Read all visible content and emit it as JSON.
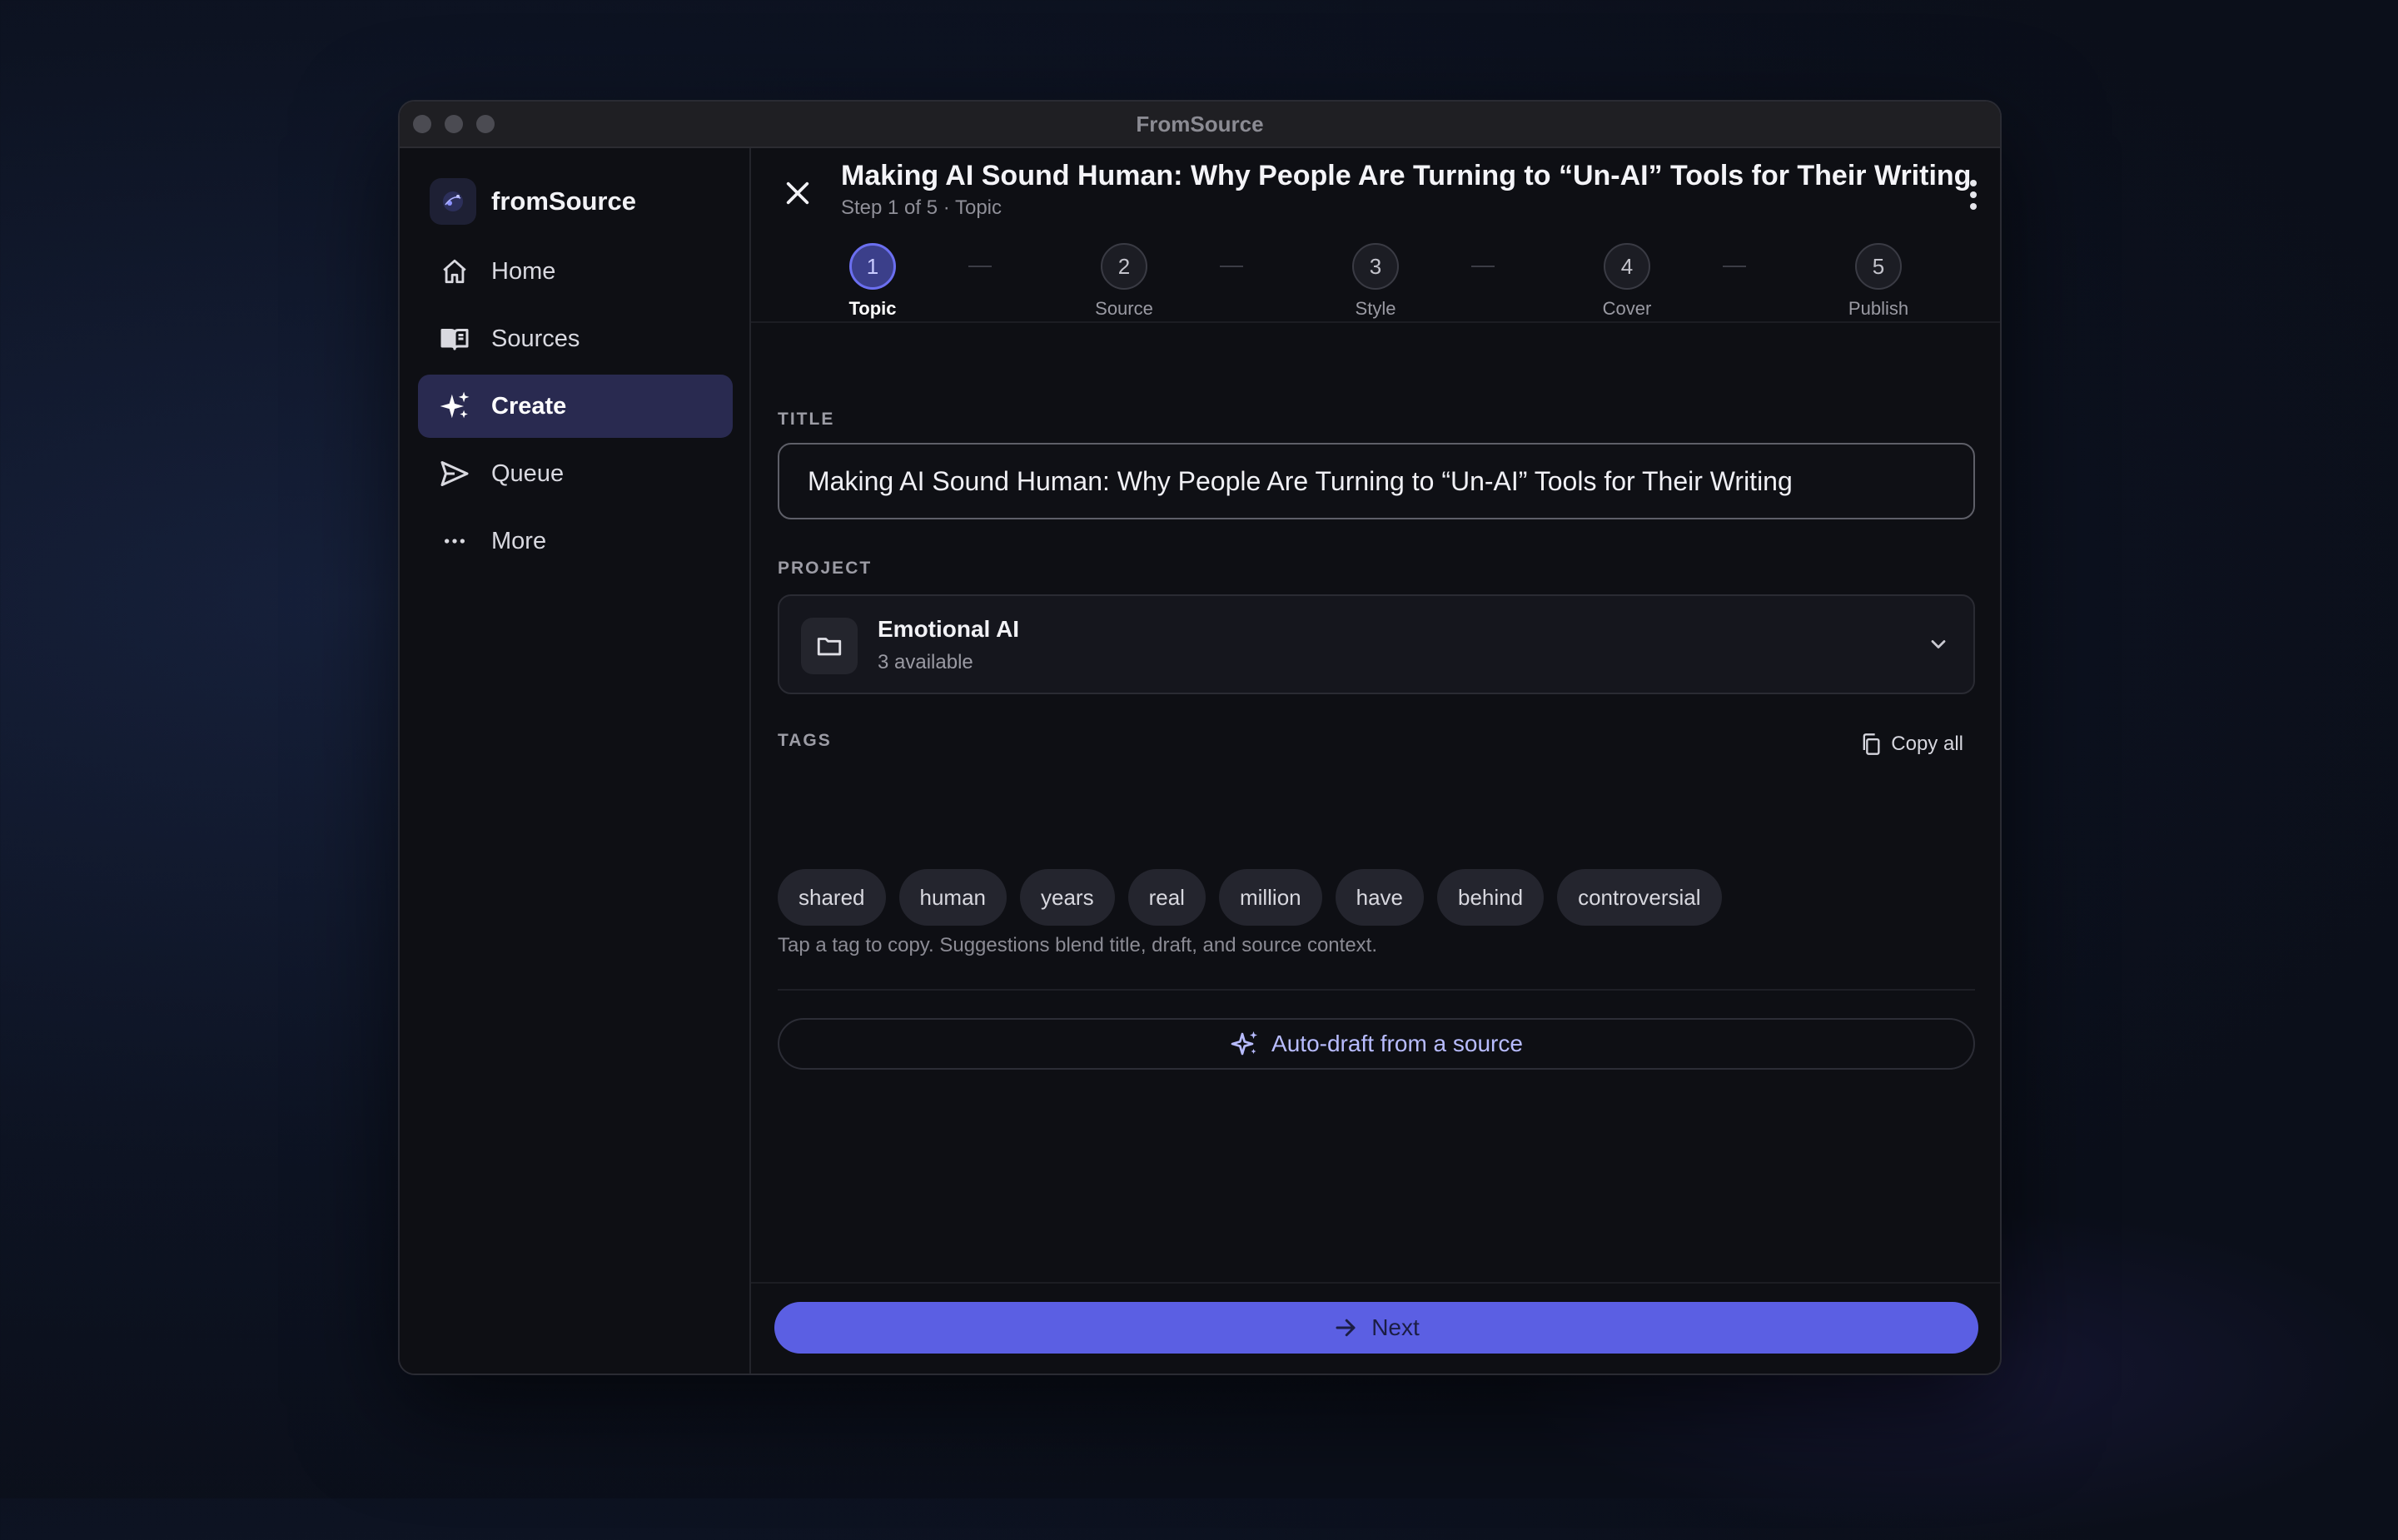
{
  "window": {
    "title": "FromSource"
  },
  "brand": {
    "name": "fromSource"
  },
  "sidebar": {
    "items": [
      {
        "label": "Home",
        "icon": "home-icon"
      },
      {
        "label": "Sources",
        "icon": "book-icon"
      },
      {
        "label": "Create",
        "icon": "sparkles-icon",
        "active": true
      },
      {
        "label": "Queue",
        "icon": "send-icon"
      },
      {
        "label": "More",
        "icon": "more-icon"
      }
    ]
  },
  "header": {
    "title": "Making AI Sound Human: Why People Are Turning to “Un-AI” Tools for Their Writing",
    "subtitle": "Step 1 of 5 · Topic"
  },
  "steps": [
    {
      "number": "1",
      "label": "Topic",
      "active": true
    },
    {
      "number": "2",
      "label": "Source"
    },
    {
      "number": "3",
      "label": "Style"
    },
    {
      "number": "4",
      "label": "Cover"
    },
    {
      "number": "5",
      "label": "Publish"
    }
  ],
  "form": {
    "title_label": "TITLE",
    "title_value": "Making AI Sound Human: Why People Are Turning to “Un-AI” Tools for Their Writing",
    "project_label": "PROJECT",
    "project_name": "Emotional AI",
    "project_sub": "3 available",
    "tags_label": "TAGS",
    "copy_all": "Copy all",
    "tags": [
      "shared",
      "human",
      "years",
      "real",
      "million",
      "have",
      "behind",
      "controversial"
    ],
    "tags_hint": "Tap a tag to copy. Suggestions blend title, draft, and source context.",
    "autodraft": "Auto-draft from a source"
  },
  "footer": {
    "next": "Next"
  },
  "colors": {
    "accent": "#5b5fe3",
    "active_nav": "#292a50",
    "background": "#0e0f14"
  }
}
